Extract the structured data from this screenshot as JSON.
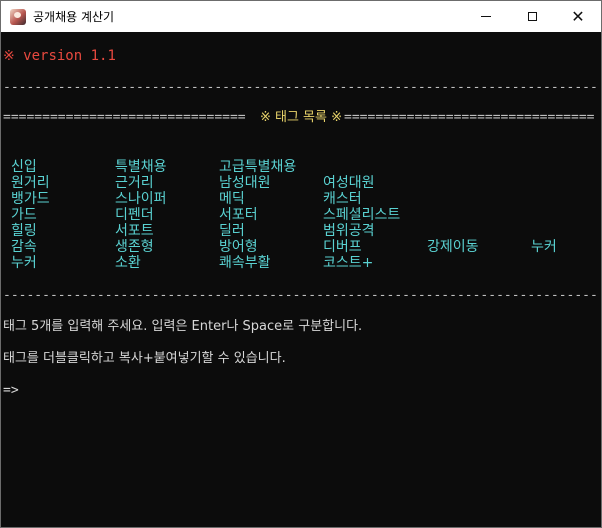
{
  "window": {
    "title": "공개채용 계산기",
    "close_glyph": "✕"
  },
  "console": {
    "version": "※ version 1.1",
    "rule_char": "------------------------------------------------------------------------------------------------------------",
    "heading_left": "===============================",
    "heading_title": "※ 태그 목록 ※",
    "heading_right": "================================",
    "tag_rows": [
      [
        "신입",
        "특별채용",
        "고급특별채용"
      ],
      [
        "원거리",
        "근거리",
        "남성대원",
        "여성대원"
      ],
      [
        "뱅가드",
        "스나이퍼",
        "메딕",
        "캐스터"
      ],
      [
        "가드",
        "디펜더",
        "서포터",
        "스페셜리스트"
      ],
      [
        "힐링",
        "서포트",
        "딜러",
        "범위공격"
      ],
      [
        "감속",
        "생존형",
        "방어형",
        "디버프",
        "강제이동",
        "누커"
      ],
      [
        "누커",
        "소환",
        "쾌속부활",
        "코스트+"
      ]
    ],
    "instruction_1": "태그 5개를 입력해 주세요. 입력은 Enter나 Space로 구분합니다.",
    "instruction_2": "태그를 더블클릭하고 복사+붙여넣기할 수 있습니다.",
    "prompt": "=>",
    "colors": {
      "version": "#e8493f",
      "heading": "#e8d36a",
      "tags": "#5ad2d2",
      "text": "#d8d8d8"
    }
  }
}
